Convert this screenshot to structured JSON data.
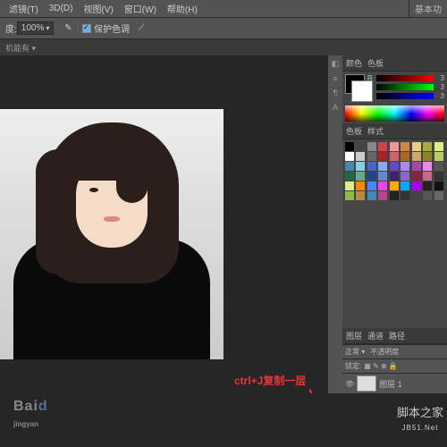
{
  "menu": {
    "items": [
      "滤镜(T)",
      "3D(D)",
      "视图(V)",
      "窗口(W)",
      "帮助(H)"
    ]
  },
  "options": {
    "zoom_label": "度:",
    "zoom_value": "100%",
    "protect_label": "保护色调",
    "basic_tab": "基本功"
  },
  "tab": {
    "label": "机能有"
  },
  "color_panel": {
    "title_a": "颜色",
    "title_b": "色板",
    "rgb": [
      {
        "l": "R",
        "v": "3"
      },
      {
        "l": "G",
        "v": "3"
      },
      {
        "l": "B",
        "v": "3"
      }
    ]
  },
  "swatch_panel": {
    "title_a": "色板",
    "title_b": "样式"
  },
  "swatches": [
    "#000",
    "#444",
    "#888",
    "#c44",
    "#e99",
    "#c84",
    "#ec8",
    "#aa4",
    "#de8",
    "#fff",
    "#ccc",
    "#666",
    "#a22",
    "#c66",
    "#a62",
    "#ca6",
    "#882",
    "#bc6",
    "#48a",
    "#8ce",
    "#46c",
    "#8ae",
    "#64c",
    "#a8e",
    "#a4a",
    "#e8e",
    "#555",
    "#264",
    "#6a8",
    "#248",
    "#68c",
    "#426",
    "#86c",
    "#824",
    "#c68",
    "#333",
    "#de8",
    "#f80",
    "#48f",
    "#e4e",
    "#fa0",
    "#0af",
    "#a0f",
    "#222",
    "#111",
    "#8b4",
    "#b84",
    "#48b",
    "#b48",
    "#222",
    "#333",
    "#444",
    "#555",
    "#666"
  ],
  "layers": {
    "title_a": "图层",
    "title_b": "通道",
    "title_c": "路径",
    "mode_label": "正常",
    "opacity_label": "不透明度",
    "lock_label": "锁定:",
    "layer1": "图层 1"
  },
  "annotation": {
    "text": "ctrl+J复制一层"
  },
  "watermark": {
    "baidu": "Bai",
    "site_cn": "脚本之家",
    "site_en": "JB51.Net",
    "jy": "jingyan"
  },
  "vtool": {
    "items": [
      "◧",
      "≡",
      "¶",
      "A"
    ]
  }
}
